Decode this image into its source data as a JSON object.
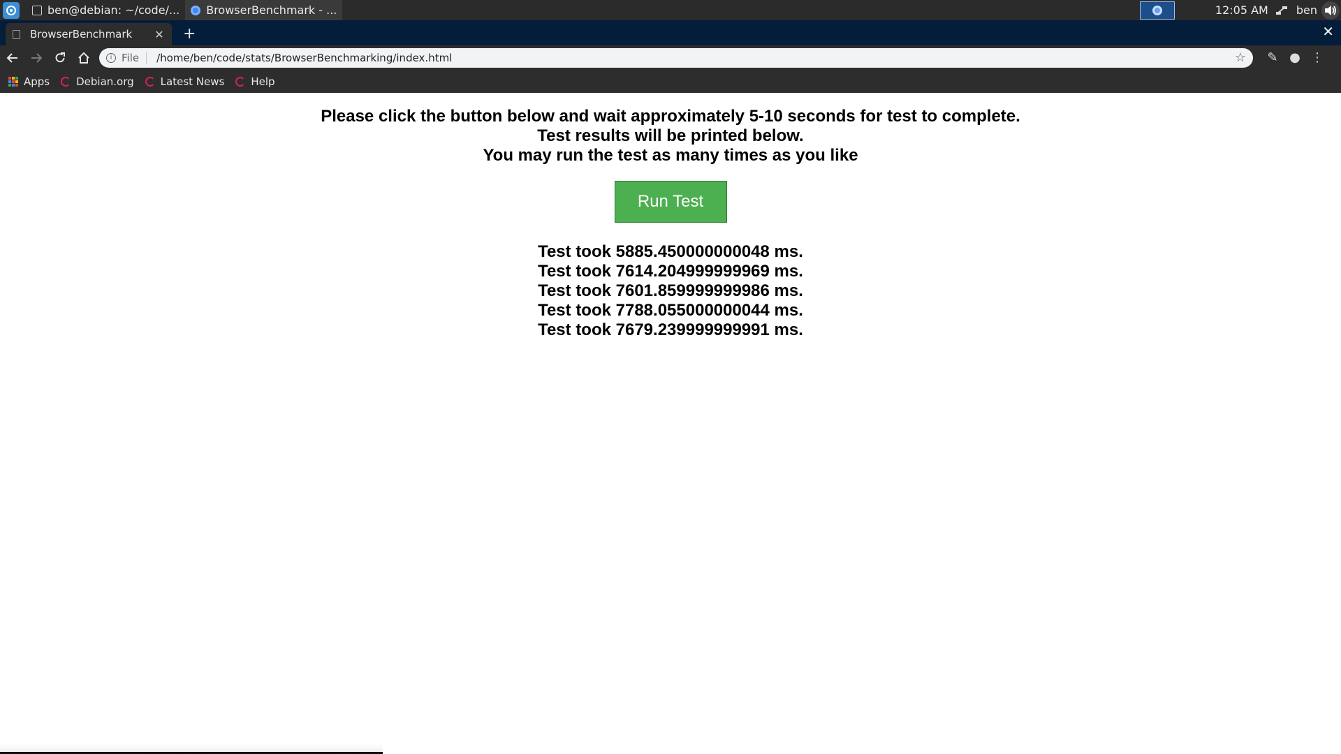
{
  "taskbar": {
    "tasks": [
      {
        "label": "ben@debian: ~/code/...",
        "icon": "terminal-icon"
      },
      {
        "label": "BrowserBenchmark - ...",
        "icon": "chromium-icon"
      }
    ],
    "clock": "12:05 AM",
    "user": "ben"
  },
  "browser": {
    "tab_title": "BrowserBenchmark",
    "omnibox": {
      "scheme": "File",
      "url": "/home/ben/code/stats/BrowserBenchmarking/index.html"
    },
    "bookmarks": [
      "Apps",
      "Debian.org",
      "Latest News",
      "Help"
    ]
  },
  "page": {
    "instructions": [
      "Please click the button below and wait approximately 5-10 seconds for test to complete.",
      "Test results will be printed below.",
      "You may run the test as many times as you like"
    ],
    "button_label": "Run Test",
    "results": [
      "Test took 5885.450000000048 ms.",
      "Test took 7614.204999999969 ms.",
      "Test took 7601.859999999986 ms.",
      "Test took 7788.055000000044 ms.",
      "Test took 7679.239999999991 ms."
    ]
  },
  "colors": {
    "button": "#4caf50",
    "tabstrip": "#041d3a",
    "toolbar": "#2d2d2d"
  }
}
